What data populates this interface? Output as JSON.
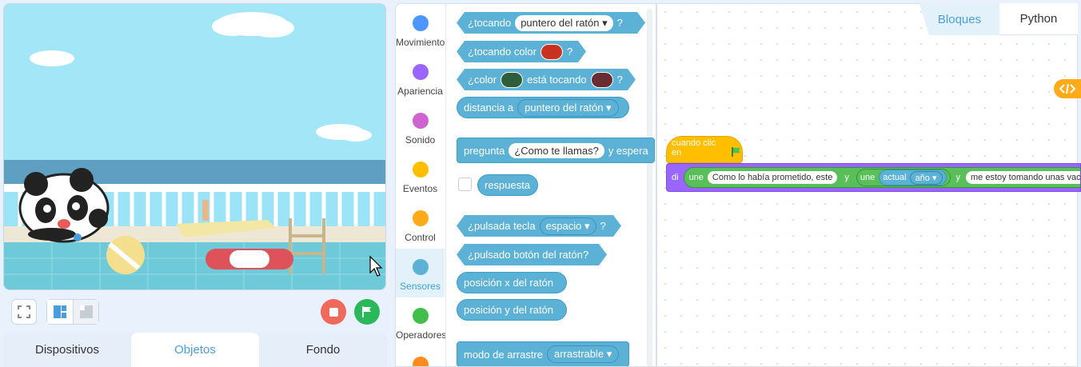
{
  "stage": {
    "scene": "pool scene with panda"
  },
  "stage_controls": {
    "fullscreen_icon": "fullscreen-icon",
    "layout_icon": "layout-icon",
    "stop_color": "#f06a5c",
    "go_color": "#2ab95a"
  },
  "bottom_tabs": [
    "Dispositivos",
    "Objetos",
    "Fondo"
  ],
  "categories": [
    {
      "label": "Movimiento",
      "color": "#4c97ff"
    },
    {
      "label": "Apariencia",
      "color": "#9966ff"
    },
    {
      "label": "Sonido",
      "color": "#cf63cf"
    },
    {
      "label": "Eventos",
      "color": "#ffbf00"
    },
    {
      "label": "Control",
      "color": "#ffab19"
    },
    {
      "label": "Sensores",
      "color": "#5cb1d6"
    },
    {
      "label": "Operadores",
      "color": "#40bf4a"
    }
  ],
  "blocks": {
    "tocando": {
      "pre": "¿tocando",
      "dd": "puntero del ratón ▾",
      "post": "?"
    },
    "tocando_color": {
      "pre": "¿tocando color",
      "post": "?",
      "color": "#c8321e"
    },
    "color_tocando": {
      "pre": "¿color",
      "mid": "está tocando",
      "post": "?",
      "c1": "#2f5e3a",
      "c2": "#6b2d34"
    },
    "distancia": {
      "pre": "distancia a",
      "dd": "puntero del ratón ▾"
    },
    "pregunta": {
      "pre": "pregunta",
      "input": "¿Como te llamas?",
      "post": "y espera"
    },
    "respuesta": "respuesta",
    "pulsada_tecla": {
      "pre": "¿pulsada tecla",
      "dd": "espacio ▾",
      "post": "?"
    },
    "pulsado_boton": "¿pulsado botón del ratón?",
    "pos_x": "posición x del ratón",
    "pos_y": "posición y del ratón",
    "arrastre": {
      "pre": "modo de arrastre",
      "dd": "arrastrable ▾"
    }
  },
  "lang_tabs": [
    "Bloques",
    "Python"
  ],
  "script": {
    "hat": "cuando clic en",
    "say": "di",
    "une1": "une",
    "text1": "Como lo había prometido, este",
    "y1": "y",
    "une2": "une",
    "actual": "actual",
    "year_dd": "año ▾",
    "y2": "y",
    "text2": "me estoy tomando unas vaca"
  }
}
